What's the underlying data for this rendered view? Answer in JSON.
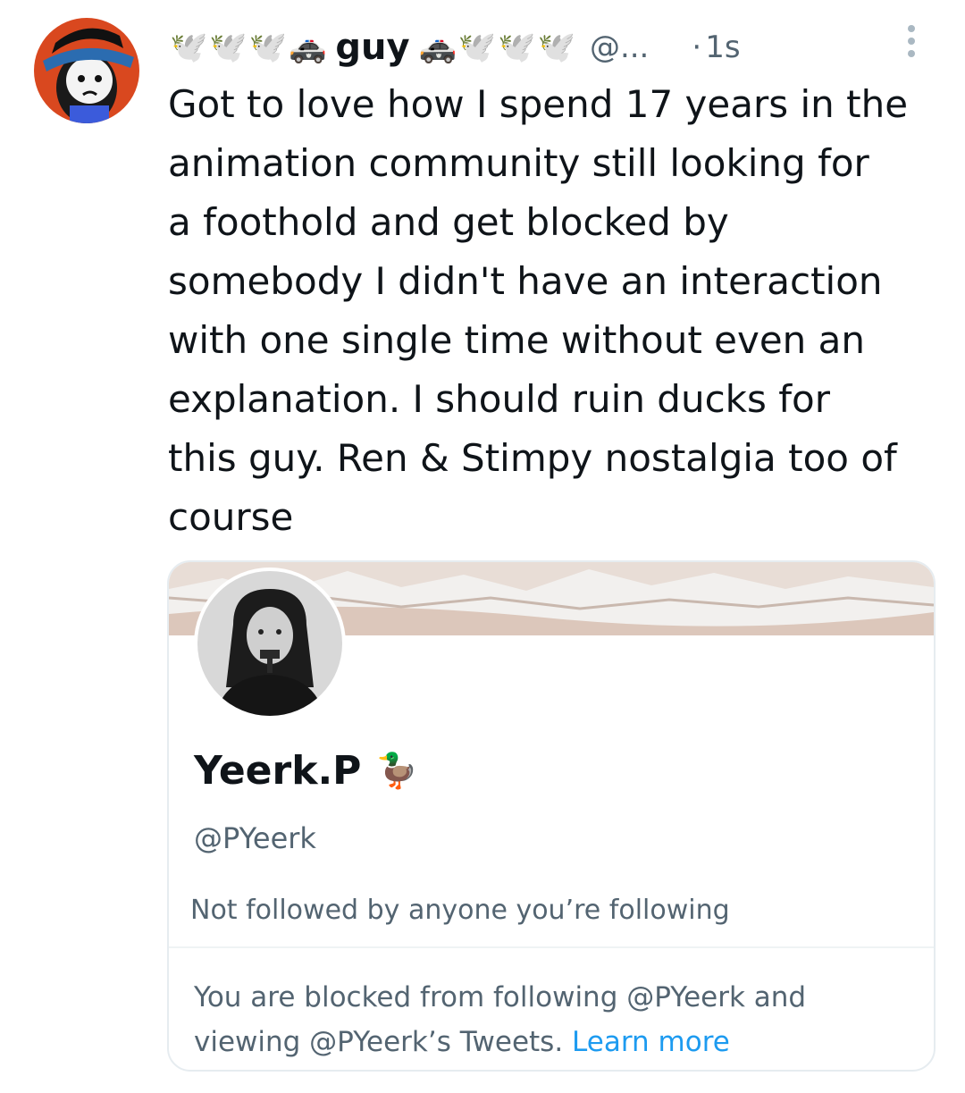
{
  "tweet": {
    "author": {
      "display_name": "guy",
      "handle": "@...",
      "name_emojis_left": [
        "🕊️",
        "🕊️",
        "🕊️",
        "🚓"
      ],
      "name_emojis_right": [
        "🚓",
        "🕊️",
        "🕊️",
        "🕊️"
      ]
    },
    "separator": "·",
    "timestamp": "1s",
    "text": "Got to love how I spend 17 years in the\nanimation community still looking for\na foothold and get blocked by\nsomebody I didn't have an interaction\nwith one single time without even an\nexplanation. I should ruin ducks for\nthis guy. Ren & Stimpy nostalgia too of\ncourse"
  },
  "profile_card": {
    "display_name": "Yeerk.P",
    "name_emoji": "🦆",
    "handle": "@PYeerk",
    "follow_context": "Not followed by anyone you’re following",
    "blocked_notice": "You are blocked from following @PYeerk and viewing @PYeerk’s Tweets.",
    "learn_more_label": "Learn more"
  },
  "colors": {
    "text_primary": "#0f1419",
    "text_secondary": "#536471",
    "link": "#1d9bf0",
    "border": "#e6ecf0"
  },
  "icons": [
    "user-avatar",
    "more-options-icon",
    "profile-picture",
    "banner-image"
  ]
}
